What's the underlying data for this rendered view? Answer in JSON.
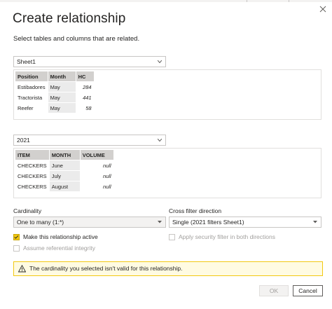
{
  "dialog": {
    "title": "Create relationship",
    "subtitle": "Select tables and columns that are related.",
    "close_icon": "close-icon"
  },
  "table1": {
    "selected": "Sheet1",
    "columns": [
      "Position",
      "Month",
      "HC"
    ],
    "rows": [
      [
        "Estibadores",
        "May",
        "284"
      ],
      [
        "Tractorista",
        "May",
        "441"
      ],
      [
        "Reefer",
        "May",
        "58"
      ]
    ]
  },
  "table2": {
    "selected": "2021",
    "columns": [
      "ITEM",
      "MONTH",
      "VOLUME"
    ],
    "rows": [
      [
        "CHECKERS",
        "June",
        "null"
      ],
      [
        "CHECKERS",
        "July",
        "null"
      ],
      [
        "CHECKERS",
        "August",
        "null"
      ]
    ]
  },
  "cardinality": {
    "label": "Cardinality",
    "value": "One to many (1:*)"
  },
  "cross_filter": {
    "label": "Cross filter direction",
    "value": "Single (2021 filters Sheet1)"
  },
  "options": {
    "make_active": {
      "label": "Make this relationship active",
      "checked": true
    },
    "referential_integrity": {
      "label": "Assume referential integrity",
      "checked": false,
      "disabled": true
    },
    "security_filter": {
      "label": "Apply security filter in both directions",
      "checked": false,
      "disabled": true
    }
  },
  "warning": {
    "icon": "warning-icon",
    "text": "The cardinality you selected isn't valid for this relationship."
  },
  "buttons": {
    "ok": "OK",
    "cancel": "Cancel"
  },
  "colors": {
    "accent_yellow": "#f2c811",
    "warning_bg": "#fffbe2",
    "header_gray": "#d2d0ce"
  }
}
